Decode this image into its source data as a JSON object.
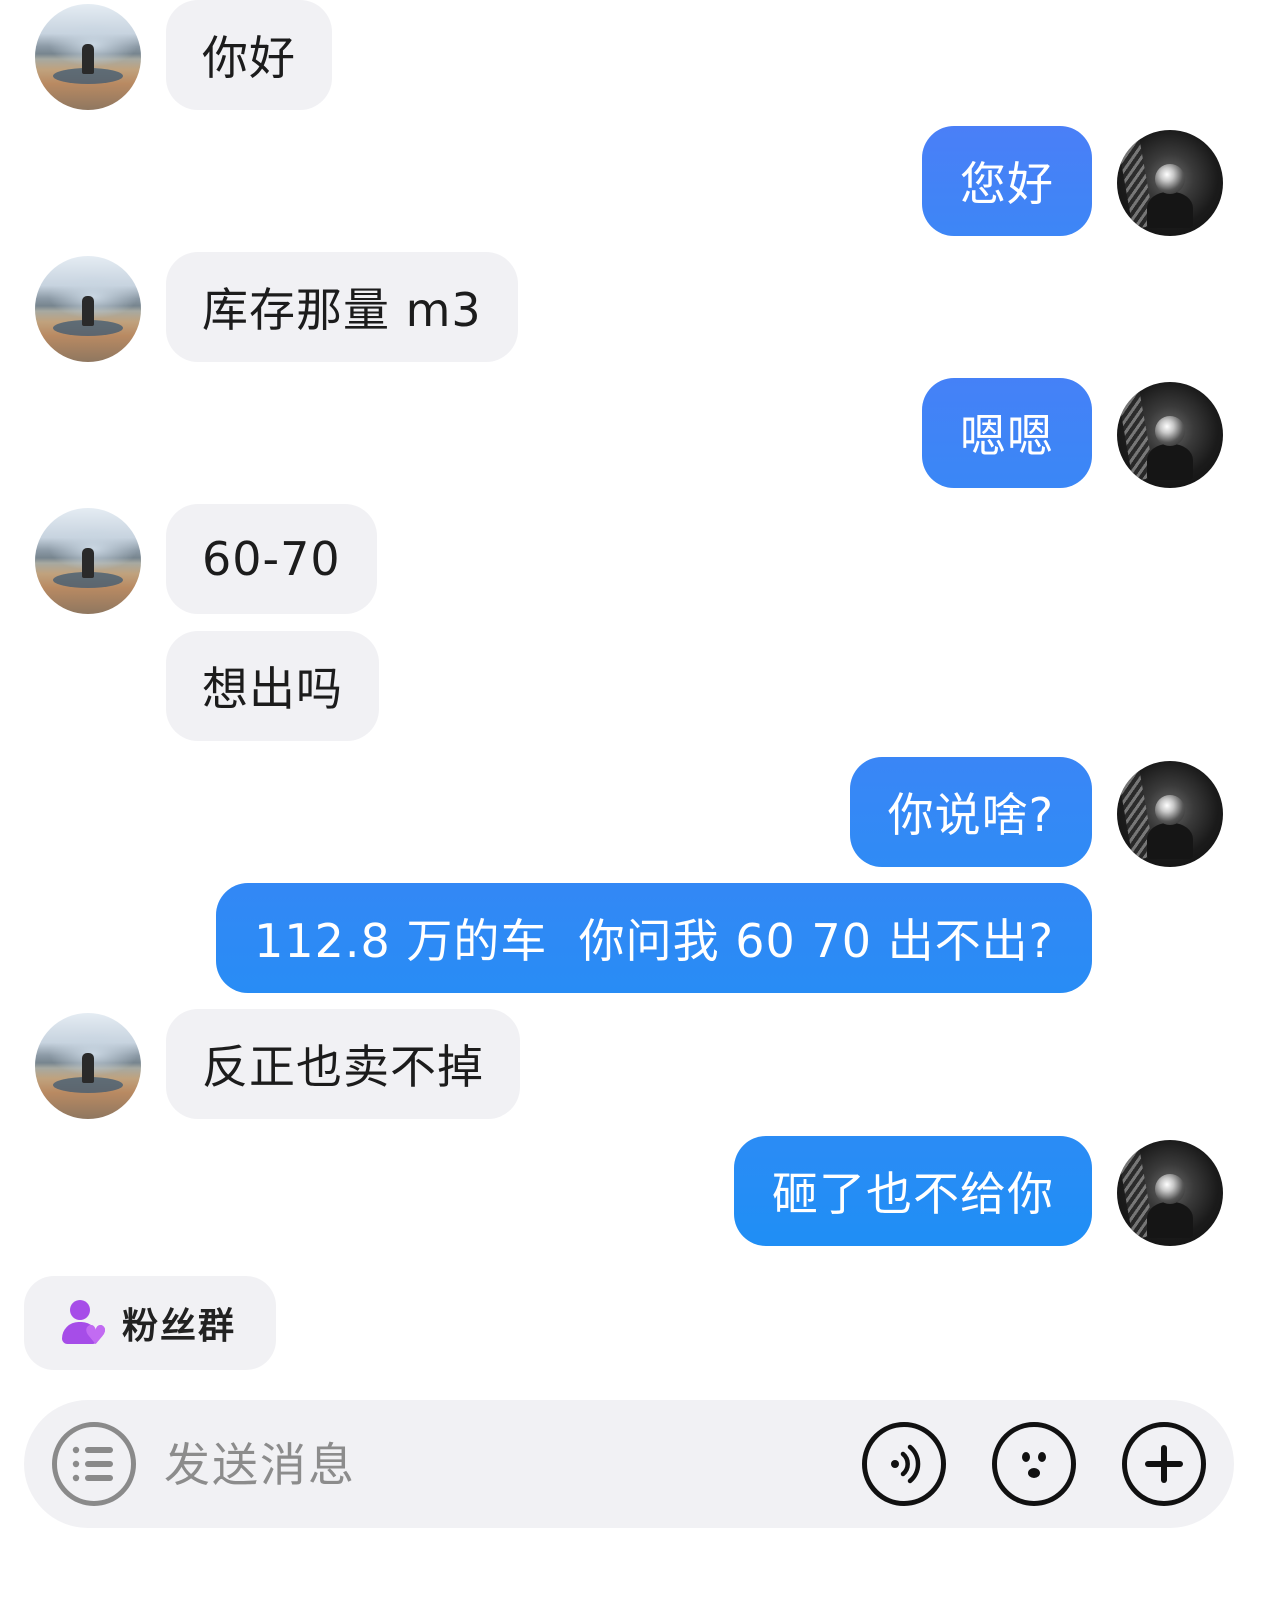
{
  "messages": [
    {
      "side": "in",
      "text": "你好"
    },
    {
      "side": "out",
      "text": "您好"
    },
    {
      "side": "in",
      "text": "库存那量 m3"
    },
    {
      "side": "out",
      "text": "嗯嗯"
    },
    {
      "side": "in",
      "text": "60-70"
    },
    {
      "side": "in",
      "text": "想出吗"
    },
    {
      "side": "out",
      "text": "你说啥?"
    },
    {
      "side": "out",
      "text": "112.8 万的车  你问我 60 70 出不出?"
    },
    {
      "side": "in",
      "text": "反正也卖不掉"
    },
    {
      "side": "out",
      "text": "砸了也不给你"
    }
  ],
  "colors": {
    "outgoing_bubble_top": "#4a7ff7",
    "outgoing_bubble_bottom": "#1f8ef5",
    "incoming_bubble": "#f1f1f4",
    "fans_icon": "#a64de8"
  },
  "fans_group": {
    "label": "粉丝群",
    "icon": "fans-group-icon"
  },
  "input_bar": {
    "placeholder": "发送消息",
    "value": "",
    "buttons": [
      "menu-icon",
      "voice-icon",
      "emoji-icon",
      "plus-icon"
    ]
  }
}
